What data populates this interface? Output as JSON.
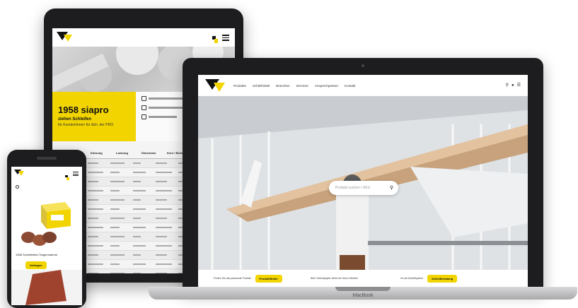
{
  "colors": {
    "brand_yellow": "#f2d500",
    "device_frame": "#1d1d1f",
    "text_dark": "#111111"
  },
  "brand": {
    "logo_icon": "sia-logo-icon"
  },
  "tablet": {
    "hero_title": "1958 siapro",
    "hero_subtitle": "ziehen Schleifen",
    "hero_text": "für Kunden/innen für dich, der PRO",
    "info_icon": "chevron-down-icon",
    "table_headers": [
      "Größe",
      "Körnung",
      "Lochung",
      "Dimension",
      "Kern / Einheit",
      "Preis"
    ]
  },
  "laptop": {
    "nav_items": [
      "Produkte",
      "Schleifmittel",
      "Branchen",
      "Services",
      "Ansprechpartner",
      "Kontakt"
    ],
    "search_placeholder": "Produkt suchen / SKU",
    "footer_left_text": "Finden Sie das passende Produkt",
    "footer_left_button": "Produktfinder",
    "footer_center_text": "Über Schleifpapier direkt bei Ihrem Händler",
    "footer_right_text": "Ihr sia Schleifsystem",
    "footer_right_button": "Schleifberatung",
    "base_label": "MacBook"
  },
  "phone": {
    "caption": "1958 Schleifmittel-Trägermaterial",
    "button": "Anfragen"
  }
}
